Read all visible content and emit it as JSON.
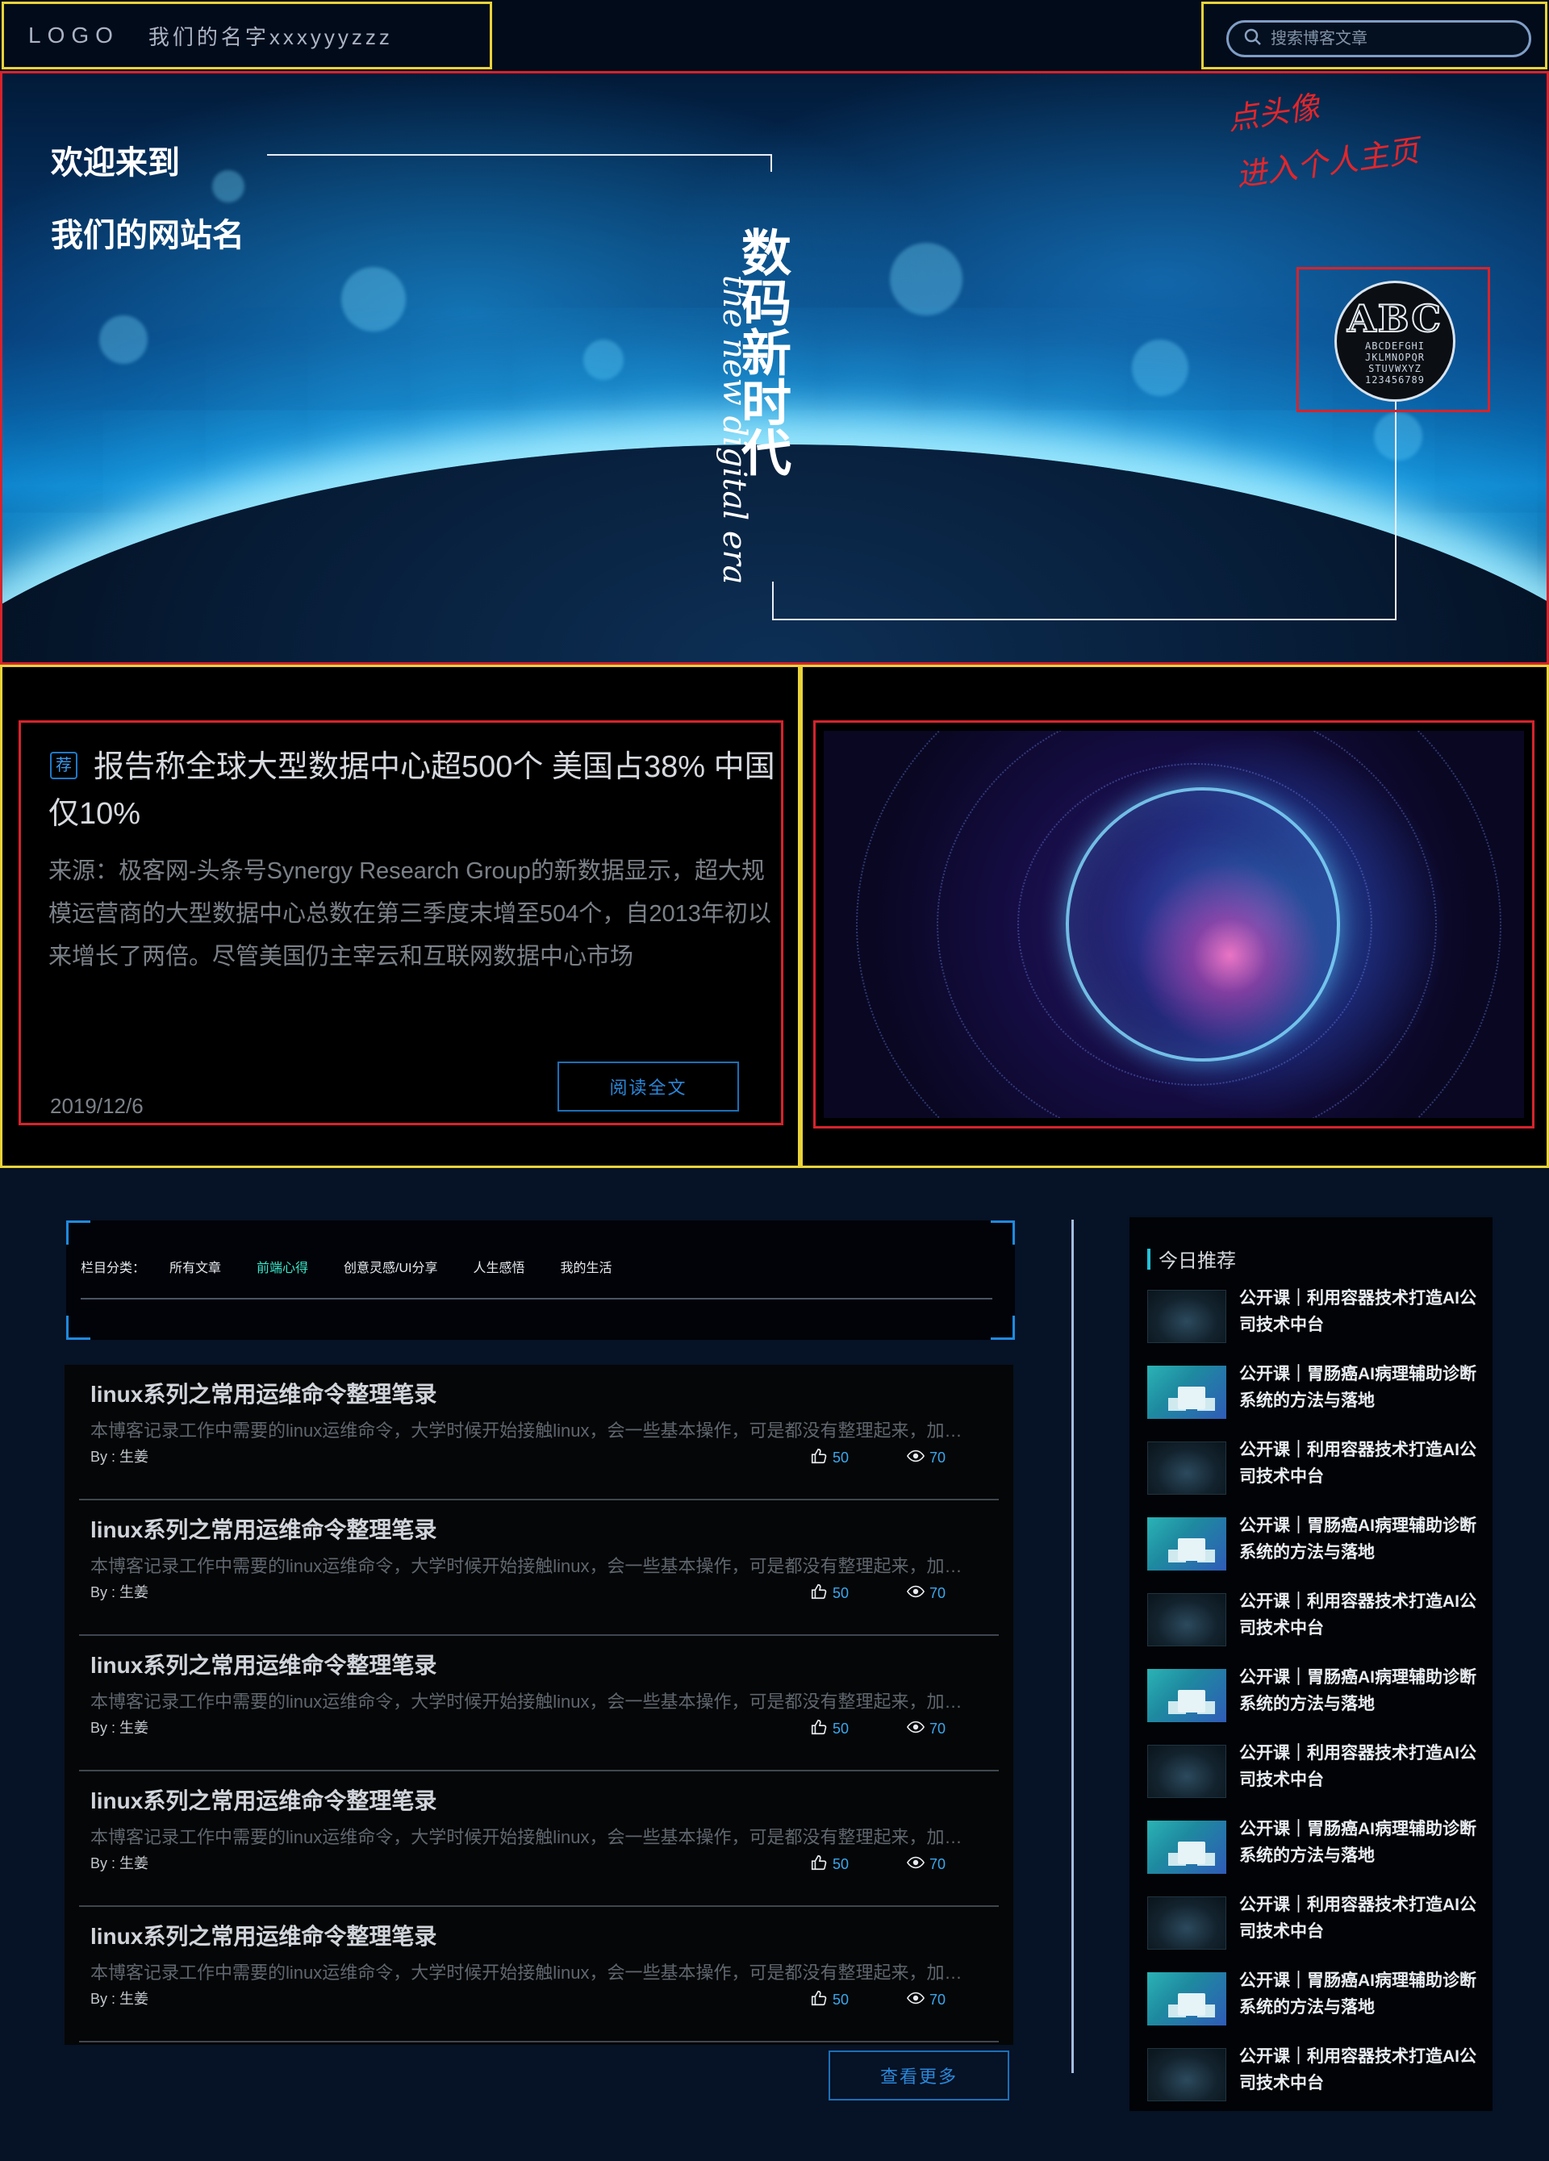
{
  "header": {
    "logo": "LOGO",
    "site_name": "我们的名字xxxyyyzzz",
    "search_placeholder": "搜索博客文章"
  },
  "hero": {
    "welcome": "欢迎来到",
    "site_name": "我们的网站名",
    "vertical_title": "数码新时代",
    "script_text": "the new digital era",
    "annotation_line1": "点头像",
    "annotation_line2": "进入个人主页",
    "avatar_letters": "ABC",
    "avatar_alphabet": [
      "ABCDEFGHI",
      "JKLMNOPQR",
      "STUVWXYZ",
      "123456789"
    ]
  },
  "featured": {
    "badge": "荐",
    "title": "报告称全球大型数据中心超500个 美国占38% 中国仅10%",
    "summary": "来源：极客网-头条号Synergy Research Group的新数据显示，超大规模运营商的大型数据中心总数在第三季度末增至504个，自2013年初以来增长了两倍。尽管美国仍主宰云和互联网数据中心市场",
    "date": "2019/12/6",
    "read_button": "阅读全文"
  },
  "categories": {
    "label": "栏目分类：",
    "items": [
      "所有文章",
      "前端心得",
      "创意灵感/UI分享",
      "人生感悟",
      "我的生活"
    ],
    "active_index": 1
  },
  "posts": [
    {
      "title": "linux系列之常用运维命令整理笔录",
      "excerpt": "本博客记录工作中需要的linux运维命令，大学时候开始接触linux，会一些基本操作，可是都没有整理起来，加上平时工作的需要，整理一下。",
      "author": "By : 生姜",
      "likes": "50",
      "views": "70"
    },
    {
      "title": "linux系列之常用运维命令整理笔录",
      "excerpt": "本博客记录工作中需要的linux运维命令，大学时候开始接触linux，会一些基本操作，可是都没有整理起来，加上平时工作的需要，整理一下。",
      "author": "By : 生姜",
      "likes": "50",
      "views": "70"
    },
    {
      "title": "linux系列之常用运维命令整理笔录",
      "excerpt": "本博客记录工作中需要的linux运维命令，大学时候开始接触linux，会一些基本操作，可是都没有整理起来，加上平时工作的需要，整理一下。",
      "author": "By : 生姜",
      "likes": "50",
      "views": "70"
    },
    {
      "title": "linux系列之常用运维命令整理笔录",
      "excerpt": "本博客记录工作中需要的linux运维命令，大学时候开始接触linux，会一些基本操作，可是都没有整理起来，加上平时工作的需要，整理一下。",
      "author": "By : 生姜",
      "likes": "50",
      "views": "70"
    },
    {
      "title": "linux系列之常用运维命令整理笔录",
      "excerpt": "本博客记录工作中需要的linux运维命令，大学时候开始接触linux，会一些基本操作，可是都没有整理起来，加上平时工作的需要，整理一下。",
      "author": "By : 生姜",
      "likes": "50",
      "views": "70"
    }
  ],
  "more_button": "查看更多",
  "sidebar": {
    "title": "今日推荐",
    "items": [
      {
        "title": "公开课｜利用容器技术打造AI公司技术中台",
        "thumb": "dark"
      },
      {
        "title": "公开课｜胃肠癌AI病理辅助诊断系统的方法与落地",
        "thumb": "teal"
      },
      {
        "title": "公开课｜利用容器技术打造AI公司技术中台",
        "thumb": "dark"
      },
      {
        "title": "公开课｜胃肠癌AI病理辅助诊断系统的方法与落地",
        "thumb": "teal"
      },
      {
        "title": "公开课｜利用容器技术打造AI公司技术中台",
        "thumb": "dark"
      },
      {
        "title": "公开课｜胃肠癌AI病理辅助诊断系统的方法与落地",
        "thumb": "teal"
      },
      {
        "title": "公开课｜利用容器技术打造AI公司技术中台",
        "thumb": "dark"
      },
      {
        "title": "公开课｜胃肠癌AI病理辅助诊断系统的方法与落地",
        "thumb": "teal"
      },
      {
        "title": "公开课｜利用容器技术打造AI公司技术中台",
        "thumb": "dark"
      },
      {
        "title": "公开课｜胃肠癌AI病理辅助诊断系统的方法与落地",
        "thumb": "teal"
      },
      {
        "title": "公开课｜利用容器技术打造AI公司技术中台",
        "thumb": "dark"
      }
    ]
  },
  "colors": {
    "accent_blue": "#1f79c8",
    "active_category": "#3ce6ca",
    "annotation_red": "#e2262b",
    "layout_frame_yellow": "#e9d33a",
    "layout_frame_red": "#d7232b"
  }
}
